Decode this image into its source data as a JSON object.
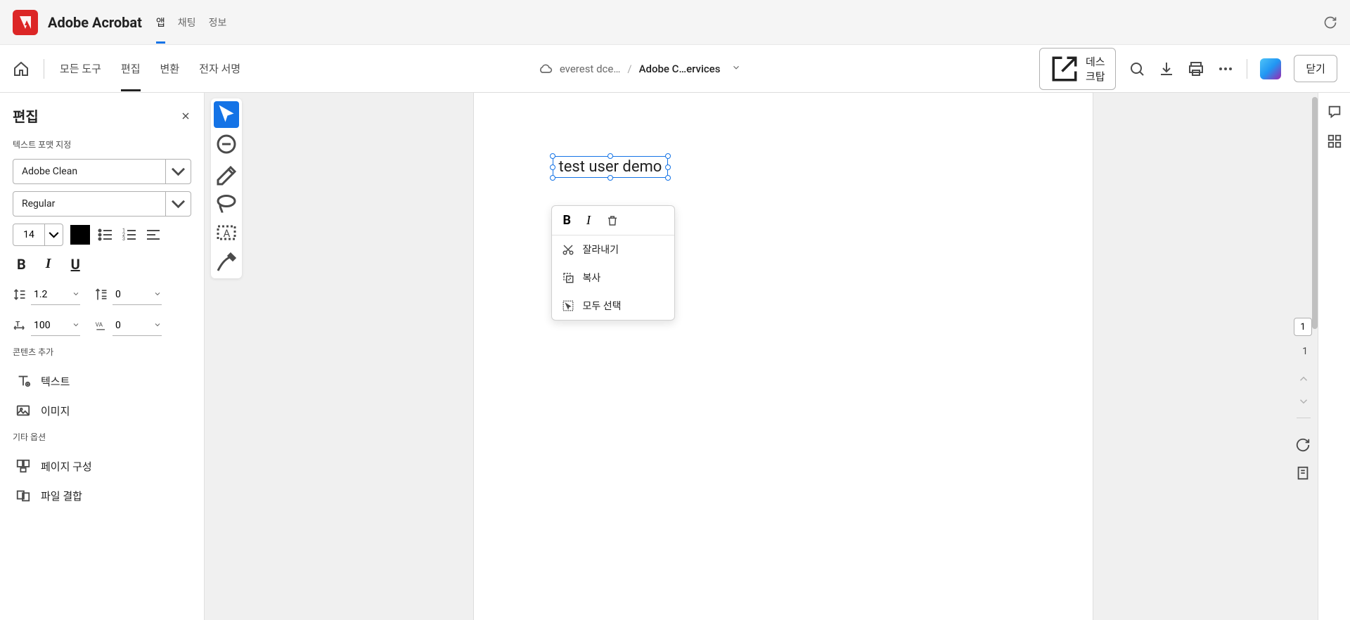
{
  "header": {
    "app_name": "Adobe Acrobat",
    "tabs": {
      "app": "앱",
      "chat": "채팅",
      "info": "정보"
    }
  },
  "toolbar": {
    "sub_tabs": {
      "all_tools": "모든 도구",
      "edit": "편집",
      "convert": "변환",
      "esign": "전자 서명"
    },
    "breadcrumb": {
      "folder": "everest dce…",
      "file": "Adobe C…ervices"
    },
    "desktop_btn": "데스크탑",
    "close_btn": "닫기"
  },
  "left_panel": {
    "title": "편집",
    "sections": {
      "text_format": "텍스트 포맷 지정",
      "add_content": "콘텐츠 추가",
      "other": "기타 옵션"
    },
    "font_family": "Adobe Clean",
    "font_weight": "Regular",
    "font_size": "14",
    "line_height": "1.2",
    "para_spacing": "0",
    "h_scale": "100",
    "char_spacing": "0",
    "add": {
      "text": "텍스트",
      "image": "이미지"
    },
    "other": {
      "pages": "페이지 구성",
      "combine": "파일 결합"
    }
  },
  "canvas": {
    "selected_text": "test user demo"
  },
  "context_menu": {
    "cut": "잘라내기",
    "copy": "복사",
    "select_all": "모두 선택"
  },
  "pagination": {
    "current": "1",
    "total": "1"
  }
}
